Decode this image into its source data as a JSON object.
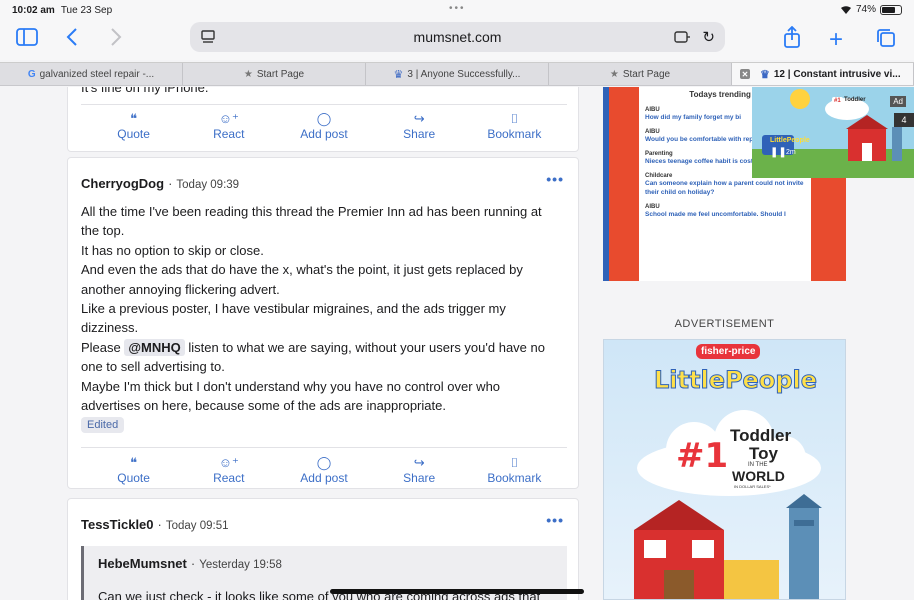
{
  "status": {
    "time": "10:02 am",
    "date": "Tue 23 Sep",
    "battery": "74%",
    "battery_level": 0.74
  },
  "browser": {
    "url": "mumsnet.com",
    "tabs": [
      {
        "label": "galvanized steel repair -...",
        "icon": "google-icon"
      },
      {
        "label": "Start Page",
        "icon": "star-icon"
      },
      {
        "label": "3 | Anyone Successfully...",
        "icon": "mumsnet-icon"
      },
      {
        "label": "Start Page",
        "icon": "star-icon"
      },
      {
        "label": "12 | Constant intrusive vi...",
        "icon": "mumsnet-icon",
        "active": true
      }
    ]
  },
  "actions": {
    "quote": "Quote",
    "react": "React",
    "add_post": "Add post",
    "share": "Share",
    "bookmark": "Bookmark"
  },
  "top_partial_text": "It's fine on my iPhone.",
  "post1": {
    "user": "CherryogDog",
    "time": "Today 09:39",
    "l1": "All the time I've been reading this thread the Premier Inn ad has been running at the top.",
    "l2": "It has no option to skip or close.",
    "l3": "And even the ads that do have the x, what's the point, it just gets replaced by another annoying flickering advert.",
    "l4": "Like a previous poster, I have vestibular migraines, and the ads trigger my dizziness.",
    "l5_pre": "Please",
    "mention": "@MNHQ",
    "l5_post": "listen to what we are saying, without your users you'd have no one to sell advertising to.",
    "l6": "Maybe I'm thick but I don't understand why you have no control over who advertises on here, because some of the ads are inappropriate.",
    "edited": "Edited"
  },
  "post2": {
    "user": "TessTickle0",
    "time": "Today 09:51",
    "quote_user": "HebeMumsnet",
    "quote_time": "Yesterday 19:58",
    "quote_text": "Can we just check - it looks like some of you who are coming across ads that"
  },
  "sidebar": {
    "trending_title": "Todays trending th",
    "trending": [
      {
        "cat": "AIBU",
        "title": "How did my family forget my bi"
      },
      {
        "cat": "AIBU",
        "title": "Would you be comfortable with repayment?"
      },
      {
        "cat": "Parenting",
        "title": "Nieces teenage coffee habit is costing ME money!"
      },
      {
        "cat": "Childcare",
        "title": "Can someone explain how a parent could not invite their child on holiday?"
      },
      {
        "cat": "AIBU",
        "title": "School made me feel uncomfortable. Should I"
      }
    ],
    "advertisement_label": "ADVERTISEMENT"
  },
  "ad": {
    "brand": "fisher-price",
    "product": "LittlePeople",
    "rank": "#1",
    "line1": "Toddler",
    "line2": "Toy",
    "line3": "IN THE",
    "line4": "WORLD",
    "line5": "IN DOLLAR SALES*"
  },
  "video_ad": {
    "badge": "Ad",
    "count": "4",
    "time": "2m"
  },
  "colors": {
    "link": "#3d6fc7",
    "accent": "#2b7cf6",
    "trend_bg": "#e84b2e",
    "trend_link": "#2f62b8"
  }
}
